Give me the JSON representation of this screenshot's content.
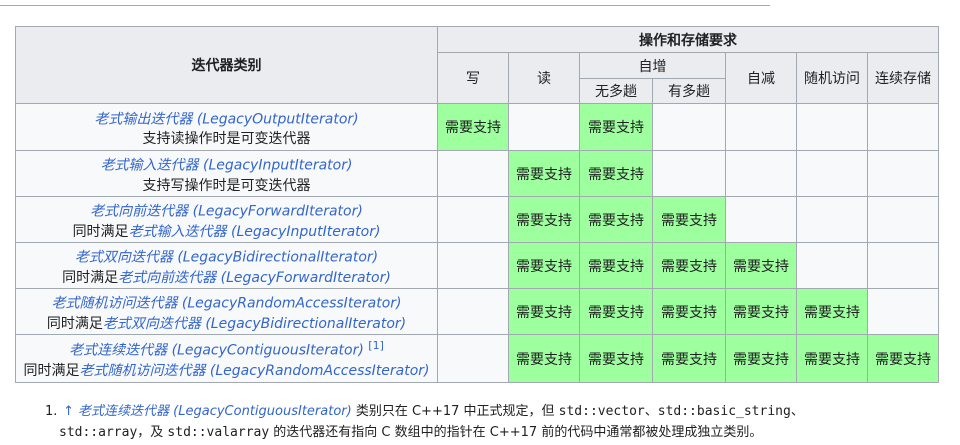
{
  "table": {
    "header": {
      "category": "迭代器类别",
      "ops_group": "操作和存储要求",
      "write": "写",
      "read": "读",
      "increment": "自增",
      "no_multipass": "无多趟",
      "multipass": "有多趟",
      "decrement": "自减",
      "random_access": "随机访问",
      "contiguous": "连续存储"
    },
    "support_label": "需要支持",
    "rows": [
      {
        "name": "老式输出迭代器 (LegacyOutputIterator)",
        "note_prefix": "支持读操作时是可变迭代器",
        "note_link": "",
        "ref": "",
        "req": [
          true,
          false,
          true,
          false,
          false,
          false,
          false
        ]
      },
      {
        "name": "老式输入迭代器 (LegacyInputIterator)",
        "note_prefix": "支持写操作时是可变迭代器",
        "note_link": "",
        "ref": "",
        "req": [
          false,
          true,
          true,
          false,
          false,
          false,
          false
        ]
      },
      {
        "name": "老式向前迭代器 (LegacyForwardIterator)",
        "note_prefix": "同时满足",
        "note_link": "老式输入迭代器 (LegacyInputIterator)",
        "ref": "",
        "req": [
          false,
          true,
          true,
          true,
          false,
          false,
          false
        ]
      },
      {
        "name": "老式双向迭代器 (LegacyBidirectionalIterator)",
        "note_prefix": "同时满足",
        "note_link": "老式向前迭代器 (LegacyForwardIterator)",
        "ref": "",
        "req": [
          false,
          true,
          true,
          true,
          true,
          false,
          false
        ]
      },
      {
        "name": "老式随机访问迭代器 (LegacyRandomAccessIterator)",
        "note_prefix": "同时满足",
        "note_link": "老式双向迭代器 (LegacyBidirectionalIterator)",
        "ref": "",
        "req": [
          false,
          true,
          true,
          true,
          true,
          true,
          false
        ]
      },
      {
        "name": "老式连续迭代器 (LegacyContiguousIterator)",
        "note_prefix": "同时满足",
        "note_link": "老式随机访问迭代器 (LegacyRandomAccessIterator)",
        "ref": "[1]",
        "req": [
          false,
          true,
          true,
          true,
          true,
          true,
          true
        ]
      }
    ]
  },
  "footnote": {
    "number": "1.",
    "backlink": "↑",
    "link": "老式连续迭代器 (LegacyContiguousIterator)",
    "t1": " 类别只在 C++17 中正式规定，但 ",
    "code1": "std::vector",
    "sep1": "、",
    "code2": "std::basic_string",
    "sep2": "、",
    "code3": "std::array",
    "t2": "，及 ",
    "code4": "std::valarray",
    "t3": " 的迭代器还有指向 C 数组中的指针在 C++17 前的代码中通常都被处理成独立类别。"
  },
  "colors": {
    "supported": "#9eff9e",
    "header_bg": "#eaecf0",
    "cell_bg": "#f8f9fa",
    "link": "#3366cc",
    "border": "#a2a9b1"
  }
}
